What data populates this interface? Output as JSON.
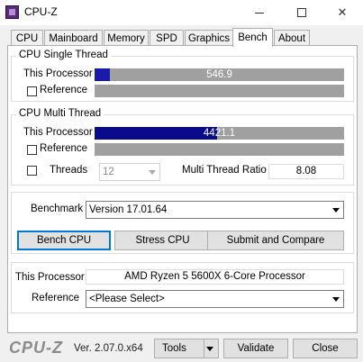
{
  "window": {
    "title": "CPU-Z"
  },
  "tabs": [
    {
      "label": "CPU"
    },
    {
      "label": "Mainboard"
    },
    {
      "label": "Memory"
    },
    {
      "label": "SPD"
    },
    {
      "label": "Graphics"
    },
    {
      "label": "Bench",
      "active": true
    },
    {
      "label": "About"
    }
  ],
  "single_thread": {
    "title": "CPU Single Thread",
    "processor_label": "This Processor",
    "processor_value": "546.9",
    "processor_fill_fraction": 0.06,
    "reference_label": "Reference",
    "reference_checked": false
  },
  "multi_thread": {
    "title": "CPU Multi Thread",
    "processor_label": "This Processor",
    "processor_value": "4421.1",
    "processor_fill_fraction": 0.49,
    "reference_label": "Reference",
    "reference_checked": false,
    "threads_label": "Threads",
    "threads_checked": false,
    "threads_value": "12",
    "ratio_label": "Multi Thread Ratio",
    "ratio_value": "8.08"
  },
  "benchmark": {
    "label": "Benchmark",
    "version_value": "Version 17.01.64",
    "bench_cpu_label": "Bench CPU",
    "stress_cpu_label": "Stress CPU",
    "submit_label": "Submit and Compare"
  },
  "compare": {
    "processor_label": "This Processor",
    "processor_value": "AMD Ryzen 5 5600X 6-Core Processor",
    "reference_label": "Reference",
    "reference_value": "<Please Select>"
  },
  "footer": {
    "logo": "CPU-Z",
    "version": "Ver. 2.07.0.x64",
    "tools_label": "Tools",
    "validate_label": "Validate",
    "close_label": "Close"
  },
  "colors": {
    "bar_fill": "#1a1aa8",
    "bar_bg": "#a0a0a0",
    "focus_border": "#0078d7"
  },
  "icons": {
    "app": "cpuz-app-icon",
    "minimize": "minimize-icon",
    "maximize": "maximize-icon",
    "close": "close-icon",
    "dropdown": "chevron-down-icon"
  }
}
